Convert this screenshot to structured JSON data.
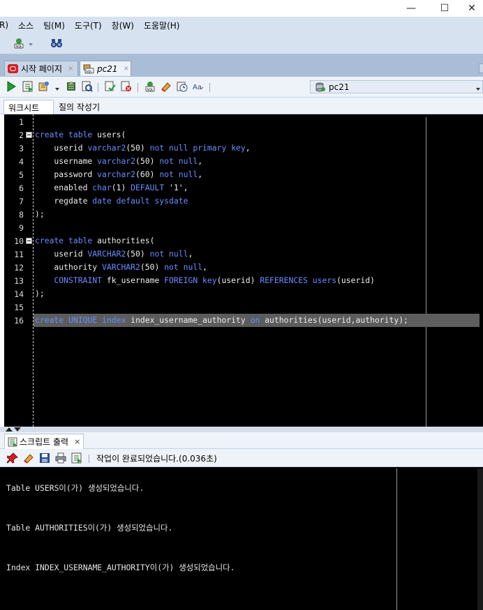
{
  "window": {
    "minimize_glyph": "—",
    "maximize_glyph": "☐",
    "close_glyph": "✕"
  },
  "menu": {
    "items": [
      "R)",
      "소스",
      "팀(M)",
      "도구(T)",
      "창(W)",
      "도움말(H)"
    ]
  },
  "doc_tabs": [
    {
      "label": "시작 페이지",
      "icon": "oracle-start-icon",
      "close": "×"
    },
    {
      "label": "pc21",
      "icon": "sql-worksheet-icon",
      "close": "×"
    }
  ],
  "connection": {
    "selected": "pc21"
  },
  "sub_tabs": [
    "워크시트",
    "질의 작성기"
  ],
  "editor": {
    "lines": [
      {
        "n": "1",
        "parts": []
      },
      {
        "n": "2",
        "fold": true,
        "parts": [
          [
            "kw",
            "create table "
          ],
          [
            "tx",
            "users("
          ]
        ]
      },
      {
        "n": "3",
        "parts": [
          [
            "tx",
            "    userid "
          ],
          [
            "kw",
            "varchar2"
          ],
          [
            "tx",
            "(50) "
          ],
          [
            "kw",
            "not null primary key"
          ],
          [
            "tx",
            ","
          ]
        ]
      },
      {
        "n": "4",
        "parts": [
          [
            "tx",
            "    username "
          ],
          [
            "kw",
            "varchar2"
          ],
          [
            "tx",
            "(50) "
          ],
          [
            "kw",
            "not null"
          ],
          [
            "tx",
            ","
          ]
        ]
      },
      {
        "n": "5",
        "parts": [
          [
            "tx",
            "    password "
          ],
          [
            "kw",
            "varchar2"
          ],
          [
            "tx",
            "(60) "
          ],
          [
            "kw",
            "not null"
          ],
          [
            "tx",
            ","
          ]
        ]
      },
      {
        "n": "6",
        "parts": [
          [
            "tx",
            "    enabled "
          ],
          [
            "kw",
            "char"
          ],
          [
            "tx",
            "(1) "
          ],
          [
            "kw",
            "DEFAULT"
          ],
          [
            "tx",
            " '1',"
          ]
        ]
      },
      {
        "n": "7",
        "parts": [
          [
            "tx",
            "    regdate "
          ],
          [
            "kw",
            "date default sysdate"
          ]
        ]
      },
      {
        "n": "8",
        "parts": [
          [
            "tx",
            ");"
          ]
        ]
      },
      {
        "n": "9",
        "parts": []
      },
      {
        "n": "10",
        "fold": true,
        "parts": [
          [
            "kw",
            "create table "
          ],
          [
            "tx",
            "authorities("
          ]
        ]
      },
      {
        "n": "11",
        "parts": [
          [
            "tx",
            "    userid "
          ],
          [
            "kw",
            "VARCHAR2"
          ],
          [
            "tx",
            "(50) "
          ],
          [
            "kw",
            "not null"
          ],
          [
            "tx",
            ","
          ]
        ]
      },
      {
        "n": "12",
        "parts": [
          [
            "tx",
            "    authority "
          ],
          [
            "kw",
            "VARCHAR2"
          ],
          [
            "tx",
            "(50) "
          ],
          [
            "kw",
            "not null"
          ],
          [
            "tx",
            ","
          ]
        ]
      },
      {
        "n": "13",
        "parts": [
          [
            "tx",
            "    "
          ],
          [
            "kw",
            "CONSTRAINT "
          ],
          [
            "tx",
            "fk_username "
          ],
          [
            "kw",
            "FOREIGN key"
          ],
          [
            "tx",
            "(userid) "
          ],
          [
            "kw",
            "REFERENCES users"
          ],
          [
            "tx",
            "(userid)"
          ]
        ]
      },
      {
        "n": "14",
        "parts": [
          [
            "tx",
            ");"
          ]
        ]
      },
      {
        "n": "15",
        "parts": []
      },
      {
        "n": "16",
        "highlight": true,
        "parts": [
          [
            "kw",
            "create UNIQUE index "
          ],
          [
            "tx",
            "index_username_authority "
          ],
          [
            "kw",
            "on "
          ],
          [
            "tx",
            "authorities(userid,authority);"
          ]
        ]
      }
    ]
  },
  "output_panel": {
    "tab_label": "스크립트 출력",
    "tab_close": "×",
    "status": "작업이 완료되었습니다.(0.036초)",
    "lines": [
      "Table USERS이(가) 생성되었습니다.",
      "Table AUTHORITIES이(가) 생성되었습니다.",
      "Index INDEX_USERNAME_AUTHORITY이(가) 생성되었습니다."
    ]
  },
  "colors": {
    "keyword": "#6b8cff",
    "editor_bg": "#000000",
    "chrome_bg": "#d6e2f0"
  }
}
